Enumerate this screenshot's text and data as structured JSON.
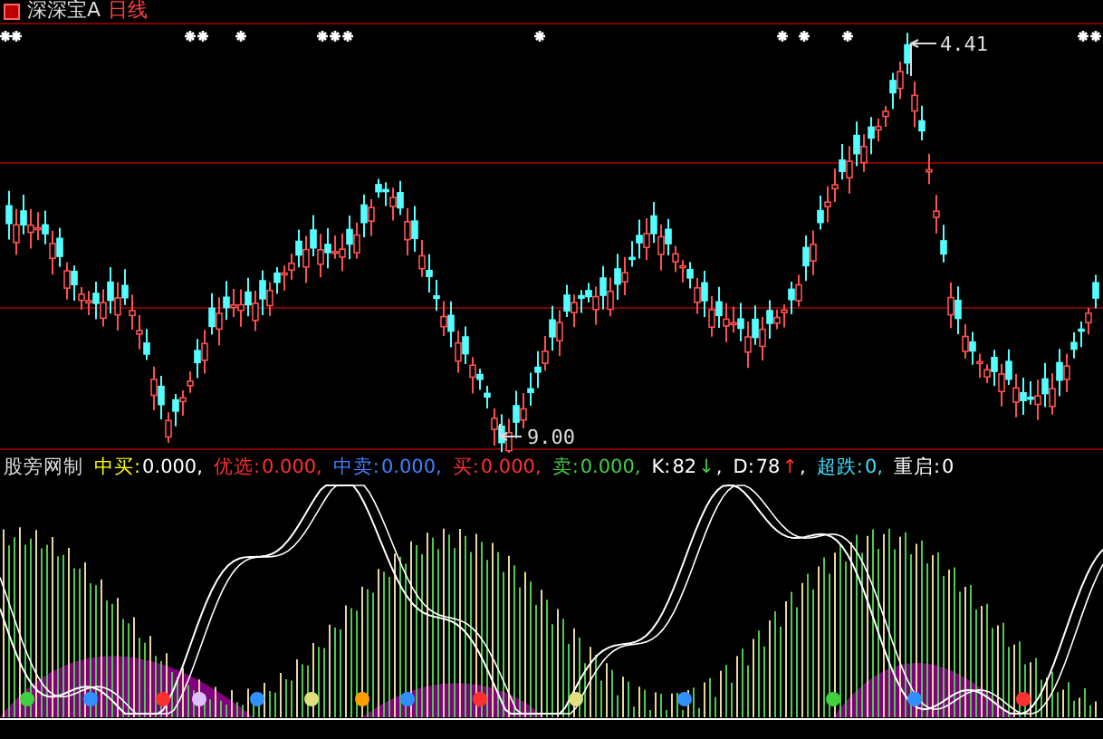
{
  "header": {
    "symbol": "深深宝A",
    "period": "日线"
  },
  "price_chart": {
    "high_label": "4.41",
    "low_label": "9.00"
  },
  "indicator": {
    "name": "股旁网制",
    "segments": [
      {
        "kind": "label",
        "text": "中买:",
        "color": "#ffff00"
      },
      {
        "kind": "value",
        "text": "0.000,",
        "color": "#ffffff"
      },
      {
        "kind": "label",
        "text": "优选:",
        "color": "#ff3030"
      },
      {
        "kind": "value",
        "text": "0.000,",
        "color": "#ff3030"
      },
      {
        "kind": "label",
        "text": "中卖:",
        "color": "#4080ff"
      },
      {
        "kind": "value",
        "text": "0.000,",
        "color": "#4080ff"
      },
      {
        "kind": "label",
        "text": "买:",
        "color": "#ff3030"
      },
      {
        "kind": "value",
        "text": "0.000,",
        "color": "#ff3030"
      },
      {
        "kind": "label",
        "text": "卖:",
        "color": "#40d040"
      },
      {
        "kind": "value",
        "text": "0.000,",
        "color": "#40d040"
      },
      {
        "kind": "label",
        "text": "K:",
        "color": "#ffffff"
      },
      {
        "kind": "value",
        "text": "82",
        "color": "#ffffff"
      },
      {
        "kind": "arrow",
        "text": "↓",
        "color": "#40d040"
      },
      {
        "kind": "value",
        "text": ",",
        "color": "#ffffff"
      },
      {
        "kind": "label",
        "text": "D:",
        "color": "#ffffff"
      },
      {
        "kind": "value",
        "text": "78",
        "color": "#ffffff"
      },
      {
        "kind": "arrow",
        "text": "↑",
        "color": "#ff3030"
      },
      {
        "kind": "value",
        "text": ",",
        "color": "#ffffff"
      },
      {
        "kind": "label",
        "text": "超跌:",
        "color": "#40e0ff"
      },
      {
        "kind": "value",
        "text": "0,",
        "color": "#40e0ff"
      },
      {
        "kind": "label",
        "text": "重启:",
        "color": "#ffffff"
      },
      {
        "kind": "value",
        "text": "0",
        "color": "#ffffff"
      }
    ]
  }
}
